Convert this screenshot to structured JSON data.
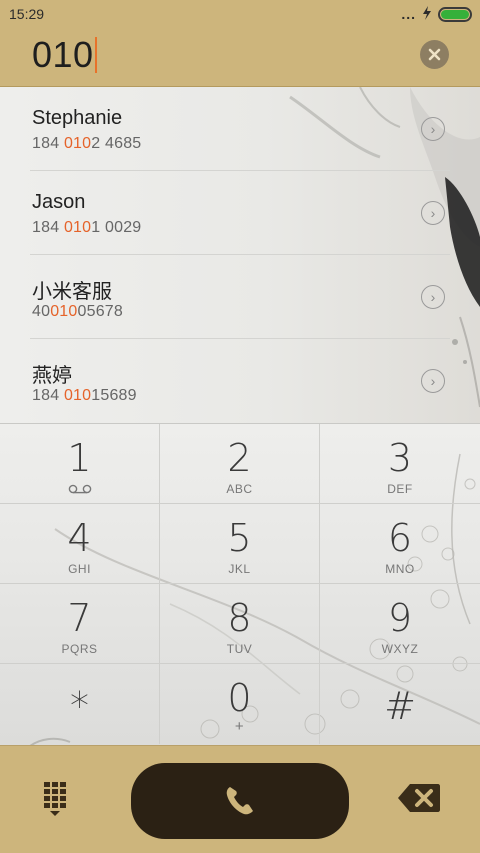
{
  "status_bar": {
    "time": "15:29",
    "signal_dots": "...",
    "battery_level": 1.0,
    "battery_color": "#35b03a"
  },
  "dial_input": {
    "number": "010"
  },
  "contacts": [
    {
      "name": "Stephanie",
      "number_prefix": "184 ",
      "number_match": "010",
      "number_suffix": "2 4685"
    },
    {
      "name": "Jason",
      "number_prefix": "184 ",
      "number_match": "010",
      "number_suffix": "1 0029"
    },
    {
      "name": "小米客服",
      "number_prefix": "40",
      "number_match": "010",
      "number_suffix": "05678"
    },
    {
      "name": "燕婷",
      "number_prefix": "184 ",
      "number_match": "010",
      "number_suffix": "15689"
    }
  ],
  "keypad": [
    {
      "digit": "1",
      "letters": ""
    },
    {
      "digit": "2",
      "letters": "ABC"
    },
    {
      "digit": "3",
      "letters": "DEF"
    },
    {
      "digit": "4",
      "letters": "GHI"
    },
    {
      "digit": "5",
      "letters": "JKL"
    },
    {
      "digit": "6",
      "letters": "MNO"
    },
    {
      "digit": "7",
      "letters": "PQRS"
    },
    {
      "digit": "8",
      "letters": "TUV"
    },
    {
      "digit": "9",
      "letters": "WXYZ"
    },
    {
      "digit": "*",
      "letters": ""
    },
    {
      "digit": "0",
      "letters": "+"
    },
    {
      "digit": "#",
      "letters": ""
    }
  ],
  "colors": {
    "accent_bar": "#cdb57c",
    "match_highlight": "#e5632a",
    "call_button": "#2b2114"
  },
  "icons": {
    "clear": "close-circle-icon",
    "contact_detail": "chevron-right-icon",
    "voicemail": "voicemail-icon",
    "dialpad": "dialpad-icon",
    "call": "phone-icon",
    "backspace": "backspace-icon"
  }
}
